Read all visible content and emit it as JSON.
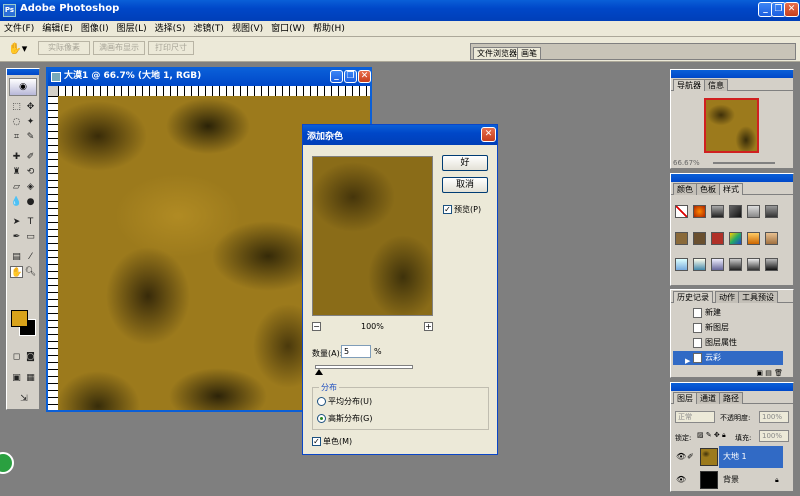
{
  "app": {
    "title": "Adobe Photoshop"
  },
  "menu": [
    "文件(F)",
    "编辑(E)",
    "图像(I)",
    "图层(L)",
    "选择(S)",
    "滤镜(T)",
    "视图(V)",
    "窗口(W)",
    "帮助(H)"
  ],
  "options": {
    "buttons": [
      "实际像素",
      "满画布显示",
      "打印尺寸"
    ],
    "tabs": [
      "文件浏览器",
      "画笔"
    ]
  },
  "document": {
    "title": "大漠1 @ 66.7% (大地 1, RGB)"
  },
  "dialog": {
    "title": "添加杂色",
    "ok": "好",
    "cancel": "取消",
    "preview_label": "预览(P)",
    "zoom": "100%",
    "amount_label": "数量(A):",
    "amount_value": "5",
    "amount_unit": "%",
    "distribution_label": "分布",
    "uniform": "平均分布(U)",
    "gaussian": "高斯分布(G)",
    "monochrome": "单色(M)",
    "minus": "−",
    "plus": "+"
  },
  "navigator": {
    "tabs": [
      "导航器",
      "信息"
    ],
    "zoom": "66.67%"
  },
  "swatches": {
    "tabs": [
      "颜色",
      "色板",
      "样式"
    ]
  },
  "history": {
    "tabs": [
      "历史记录",
      "动作",
      "工具预设"
    ],
    "items": [
      "新建",
      "新图层",
      "图层属性",
      "云彩"
    ]
  },
  "layers": {
    "tabs": [
      "图层",
      "通道",
      "路径"
    ],
    "blend": "正常",
    "opacity_label": "不透明度:",
    "opacity": "100%",
    "lock_label": "锁定:",
    "fill_label": "填充:",
    "fill": "100%",
    "rows": [
      "大地 1",
      "背景"
    ]
  },
  "colors": {
    "foreground": "#d8a21a",
    "background": "#000000",
    "accent": "#0a5fd8"
  }
}
